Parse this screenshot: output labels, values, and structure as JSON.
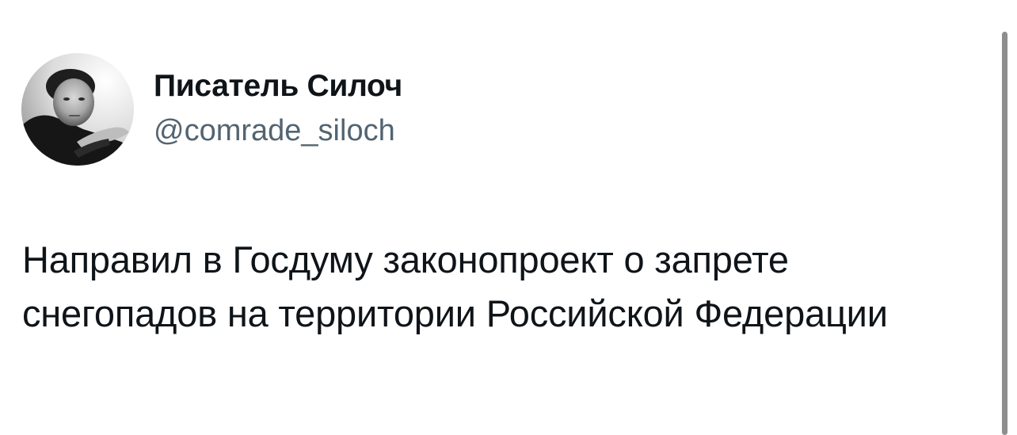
{
  "tweet": {
    "author": {
      "display_name": "Писатель Силоч",
      "handle": "@comrade_siloch",
      "avatar_icon": "profile-photo-avatar"
    },
    "text": "Направил в Госдуму законопроект о запрете снегопадов на территории Российской Федерации"
  },
  "colors": {
    "text_primary": "#0f1419",
    "text_secondary": "#536471",
    "background": "#ffffff",
    "scrollbar": "#8e8e8e"
  }
}
